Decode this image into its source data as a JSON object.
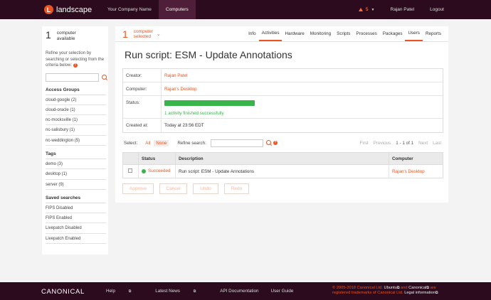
{
  "topbar": {
    "logo_letter": "L",
    "app_name": "landscape",
    "nav": [
      "Your Company Name",
      "Computers"
    ],
    "alert_count": "5",
    "user_name": "Rajan Patel",
    "logout": "Logout"
  },
  "sidebar": {
    "count": "1",
    "count_label_1": "computer",
    "count_label_2": "available",
    "refine_text": "Refine your selection by searching or selecting from the criteria below:",
    "help": "?",
    "access_groups_title": "Access Groups",
    "access_groups": [
      "cloud-google (2)",
      "cloud-oracle (1)",
      "nc-mocksville (1)",
      "nc-salisbury (1)",
      "nc-weddington (5)"
    ],
    "tags_title": "Tags",
    "tags": [
      "demo (3)",
      "desktop (1)",
      "server (9)"
    ],
    "saved_title": "Saved searches",
    "saved": [
      "FIPS Disabled",
      "FIPS Enabled",
      "Livepatch Disabled",
      "Livepatch Enabled"
    ]
  },
  "main": {
    "selected_count": "1",
    "selected_label_1": "computer",
    "selected_label_2": "selected",
    "tabs": [
      "Info",
      "Activities",
      "Hardware",
      "Monitoring",
      "Scripts",
      "Processes",
      "Packages",
      "Users",
      "Reports"
    ],
    "page_title": "Run script: ESM - Update Annotations",
    "details": {
      "creator_label": "Creator:",
      "creator": "Rajan Patel",
      "computer_label": "Computer:",
      "computer": "Rajan's Desktop",
      "status_label": "Status:",
      "progress": 1.0,
      "status_text": "1 activity finished successfully",
      "created_label": "Created at:",
      "created": "Today at 23:56 EDT"
    },
    "select_label": "Select:",
    "select_all": "All",
    "select_none": "None",
    "refine_label": "Refine search:",
    "pager": {
      "first": "First",
      "previous": "Previous",
      "current": "1 - 1 of 1",
      "next": "Next",
      "last": "Last"
    },
    "table": {
      "headers": [
        "Status",
        "Description",
        "Computer"
      ],
      "row": {
        "status": "Succeeded",
        "description": "Run script: ESM - Update Annotations",
        "computer": "Rajan's Desktop"
      }
    },
    "buttons": [
      "Approve",
      "Cancel",
      "Undo",
      "Redo"
    ]
  },
  "footer": {
    "brand": "CANONICAL",
    "links": [
      "Help",
      "Latest News",
      "API Documentation",
      "User Guide"
    ],
    "copyright": "© 2005-2018 Canonical Ltd.",
    "ubuntu": "Ubuntu",
    "and": "and",
    "canonical": "Canonical",
    "are": "are",
    "registered": "registered trademarks of Canonical Ltd.",
    "legal": "Legal information"
  },
  "colors": {
    "accent": "#e95420",
    "bar": "#2c0b1e",
    "success": "#38b44a"
  }
}
